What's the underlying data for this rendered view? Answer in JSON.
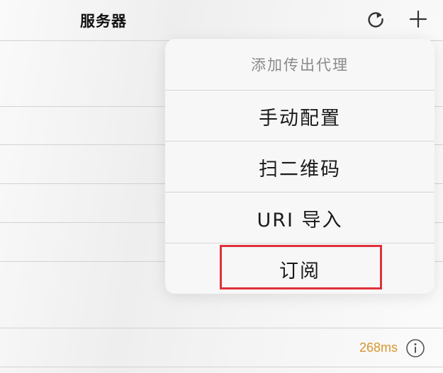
{
  "nav": {
    "title": "服务器",
    "refresh_icon": "refresh-icon",
    "add_icon": "plus-icon"
  },
  "popover": {
    "header": "添加传出代理",
    "items": [
      {
        "label": "手动配置"
      },
      {
        "label": "扫二维码"
      },
      {
        "label": "URI 导入"
      },
      {
        "label": "订阅",
        "highlighted": true
      }
    ]
  },
  "server_row": {
    "latency": "268ms",
    "info_icon": "info-icon"
  },
  "colors": {
    "latency": "#d8962f",
    "highlight": "#e0303a"
  }
}
